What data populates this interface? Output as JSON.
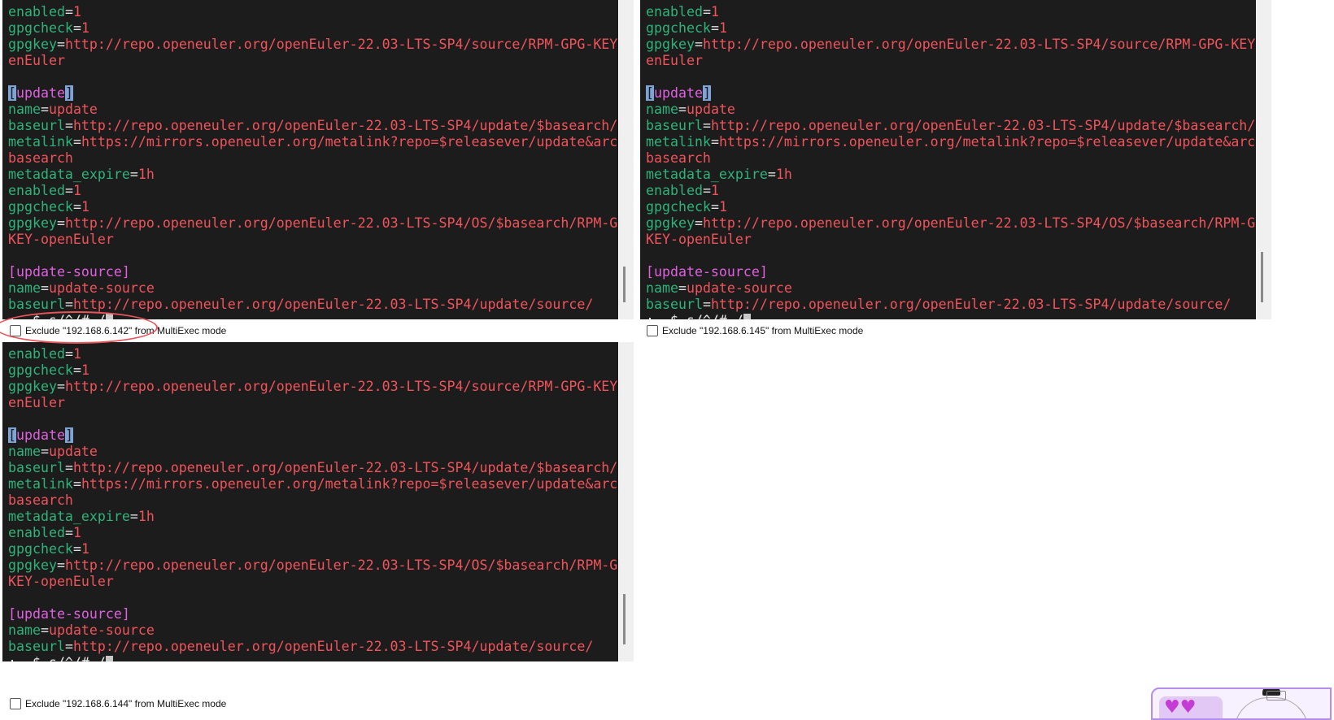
{
  "sessions": [
    {
      "ip_label": "Exclude \"192.168.6.142\" from MultiExec mode",
      "prompt": ":.,$ s/^/# /"
    },
    {
      "ip_label": "Exclude \"192.168.6.145\" from MultiExec mode",
      "prompt": ":.,$ s/^/# /"
    },
    {
      "ip_label": "Exclude \"192.168.6.144\" from MultiExec mode",
      "prompt": ":.,$ s/^/# /"
    }
  ],
  "terminal": {
    "lines": [
      [
        {
          "t": "enabled",
          "c": "k"
        },
        {
          "t": "=",
          "c": "e"
        },
        {
          "t": "1",
          "c": "v"
        }
      ],
      [
        {
          "t": "gpgcheck",
          "c": "k"
        },
        {
          "t": "=",
          "c": "e"
        },
        {
          "t": "1",
          "c": "v"
        }
      ],
      [
        {
          "t": "gpgkey",
          "c": "k"
        },
        {
          "t": "=",
          "c": "e"
        },
        {
          "t": "http://repo.openeuler.org/openEuler-22.03-LTS-SP4/source/RPM-GPG-KEY-op",
          "c": "v"
        }
      ],
      [
        {
          "t": "enEuler",
          "c": "v"
        }
      ],
      [],
      [
        {
          "t": "[",
          "c": "hl"
        },
        {
          "t": "update",
          "c": "s"
        },
        {
          "t": "]",
          "c": "hl"
        }
      ],
      [
        {
          "t": "name",
          "c": "k"
        },
        {
          "t": "=",
          "c": "e"
        },
        {
          "t": "update",
          "c": "v"
        }
      ],
      [
        {
          "t": "baseurl",
          "c": "k"
        },
        {
          "t": "=",
          "c": "e"
        },
        {
          "t": "http://repo.openeuler.org/openEuler-22.03-LTS-SP4/update/$basearch/",
          "c": "v"
        }
      ],
      [
        {
          "t": "metalink",
          "c": "k"
        },
        {
          "t": "=",
          "c": "e"
        },
        {
          "t": "https://mirrors.openeuler.org/metalink?repo=$releasever/update&arch=$",
          "c": "v"
        }
      ],
      [
        {
          "t": "basearch",
          "c": "v"
        }
      ],
      [
        {
          "t": "metadata_expire",
          "c": "k"
        },
        {
          "t": "=",
          "c": "e"
        },
        {
          "t": "1h",
          "c": "v"
        }
      ],
      [
        {
          "t": "enabled",
          "c": "k"
        },
        {
          "t": "=",
          "c": "e"
        },
        {
          "t": "1",
          "c": "v"
        }
      ],
      [
        {
          "t": "gpgcheck",
          "c": "k"
        },
        {
          "t": "=",
          "c": "e"
        },
        {
          "t": "1",
          "c": "v"
        }
      ],
      [
        {
          "t": "gpgkey",
          "c": "k"
        },
        {
          "t": "=",
          "c": "e"
        },
        {
          "t": "http://repo.openeuler.org/openEuler-22.03-LTS-SP4/OS/$basearch/RPM-GPG-",
          "c": "v"
        }
      ],
      [
        {
          "t": "KEY-openEuler",
          "c": "v"
        }
      ],
      [],
      [
        {
          "t": "[update-source]",
          "c": "s"
        }
      ],
      [
        {
          "t": "name",
          "c": "k"
        },
        {
          "t": "=",
          "c": "e"
        },
        {
          "t": "update-source",
          "c": "v"
        }
      ],
      [
        {
          "t": "baseurl",
          "c": "k"
        },
        {
          "t": "=",
          "c": "e"
        },
        {
          "t": "http://repo.openeuler.org/openEuler-22.03-LTS-SP4/update/source/",
          "c": "v"
        }
      ]
    ]
  },
  "colors": {
    "terminal_bg": "#1c1c1c",
    "key": "#2fb37a",
    "value": "#f0545b",
    "section": "#e061e0",
    "highlight": "#7ea4d6",
    "annotation": "#e8545a"
  },
  "annotation": {
    "shape": "red-oval-highlight"
  }
}
